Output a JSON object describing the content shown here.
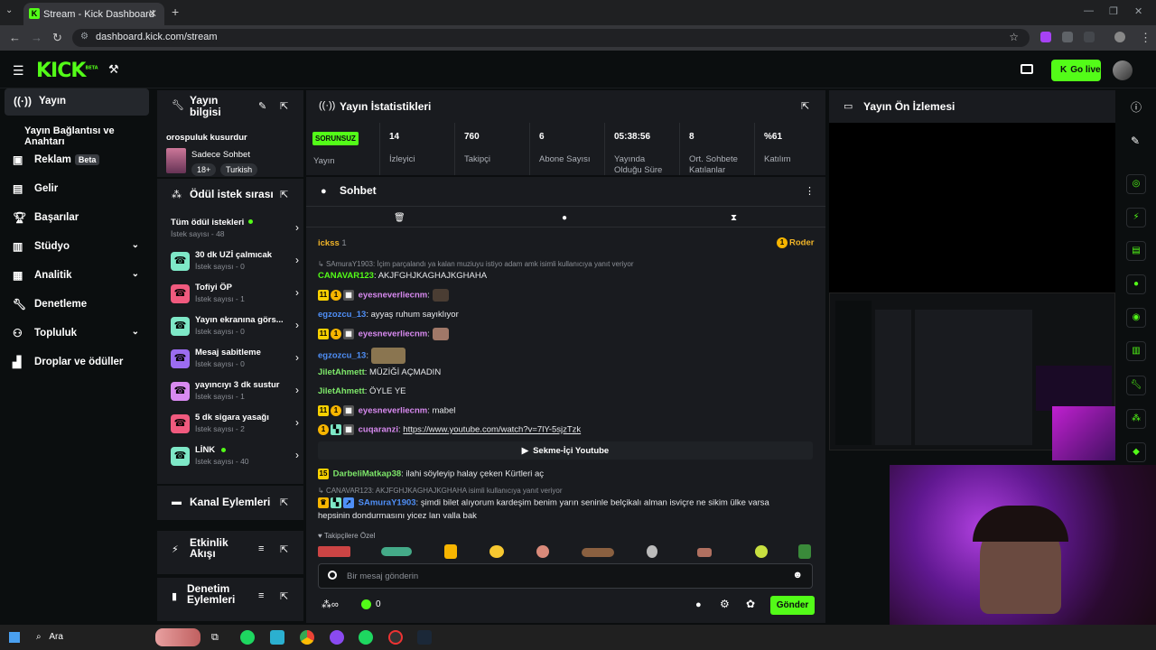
{
  "browser": {
    "tab_title": "Stream - Kick Dashboard",
    "url": "dashboard.kick.com/stream"
  },
  "header": {
    "logo": "KICK",
    "logo_badge": "BETA",
    "go_live": "Go live"
  },
  "sidebar": {
    "items": [
      {
        "label": "Yayın",
        "icon": "broadcast-icon"
      },
      {
        "label": "Yayın Bağlantısı ve Anahtarı",
        "icon": ""
      },
      {
        "label": "Reklam",
        "icon": "ad-icon",
        "badge": "Beta"
      },
      {
        "label": "Gelir",
        "icon": "chart-icon"
      },
      {
        "label": "Başarılar",
        "icon": "trophy-icon"
      },
      {
        "label": "Stüdyo",
        "icon": "studio-icon"
      },
      {
        "label": "Analitik",
        "icon": "analytics-icon"
      },
      {
        "label": "Denetleme",
        "icon": "wrench-icon"
      },
      {
        "label": "Topluluk",
        "icon": "community-icon"
      },
      {
        "label": "Droplar ve ödüller",
        "icon": "drops-icon"
      }
    ]
  },
  "stream_info": {
    "title": "Yayın bilgisi",
    "stream_title": "orospuluk kusurdur",
    "category": "Sadece Sohbet",
    "tags": [
      "18+",
      "Turkish"
    ]
  },
  "rewards": {
    "title": "Ödül istek sırası",
    "items": [
      {
        "name": "Tüm ödül istekleri",
        "count": "İstek sayısı - 48",
        "color": "#53fc18"
      },
      {
        "name": "30 dk UZİ çalmıcak",
        "count": "İstek sayısı - 0",
        "color": "#7ee8c7"
      },
      {
        "name": "Tofiyi ÖP",
        "count": "İstek sayısı - 1",
        "color": "#f05a7e"
      },
      {
        "name": "Yayın ekranına görs...",
        "count": "İstek sayısı - 0",
        "color": "#7ee8c7"
      },
      {
        "name": "Mesaj sabitleme",
        "count": "İstek sayısı - 0",
        "color": "#9b6cf0"
      },
      {
        "name": "yayıncıyı 3 dk sustur",
        "count": "İstek sayısı - 1",
        "color": "#d88af0"
      },
      {
        "name": "5 dk sigara yasağı",
        "count": "İstek sayısı - 2",
        "color": "#f05a7e"
      },
      {
        "name": "LİNK",
        "count": "İstek sayısı - 40",
        "color": "#7ee8c7"
      }
    ]
  },
  "channel_actions": {
    "title": "Kanal Eylemleri"
  },
  "activity": {
    "title": "Etkinlik Akışı"
  },
  "mod_actions": {
    "title": "Denetim Eylemleri"
  },
  "stats": {
    "title": "Yayın İstatistikleri",
    "status": "SORUNSUZ",
    "status_label": "Yayın",
    "items": [
      {
        "value": "14",
        "label": "İzleyici"
      },
      {
        "value": "760",
        "label": "Takipçi"
      },
      {
        "value": "6",
        "label": "Abone Sayısı"
      },
      {
        "value": "05:38:56",
        "label": "Yayında Olduğu Süre"
      },
      {
        "value": "8",
        "label": "Ort. Sohbete Katılanlar"
      },
      {
        "value": "%61",
        "label": "Katılım"
      }
    ]
  },
  "preview": {
    "title": "Yayın Ön İzlemesi"
  },
  "chat": {
    "title": "Sohbet",
    "pinned_user": "ickss",
    "pinned_count": "1",
    "pinned_role": "Roder",
    "messages": [
      {
        "reply": "SAmuraY1903: İçim parçalandı ya kalan muziuyu istiyo adam amk isimli kullanıcıya yanıt veriyor"
      },
      {
        "user": "CANAVAR123",
        "text": "AKJFGHJKAGHAJKGHAHA",
        "color": "#53fc18"
      },
      {
        "user": "eyesneverliecnm",
        "text": "",
        "color": "#d88af0",
        "badge": "11"
      },
      {
        "user": "egzozcu_13",
        "text": "ayyaş ruhum sayıklıyor",
        "color": "#4f8ff7"
      },
      {
        "user": "eyesneverliecnm",
        "text": "",
        "color": "#d88af0",
        "badge": "11"
      },
      {
        "user": "egzozcu_13",
        "text": "",
        "color": "#4f8ff7"
      },
      {
        "user": "JiletAhmett",
        "text": "MÜZİĞİ AÇMADIN",
        "color": "#7ee86a"
      },
      {
        "user": "JiletAhmett",
        "text": "ÖYLE YE",
        "color": "#7ee86a"
      },
      {
        "user": "eyesneverliecnm",
        "text": "mabel",
        "color": "#d88af0",
        "badge": "11"
      },
      {
        "user": "cuqaranzi",
        "text": "https://www.youtube.com/watch?v=7lY-5sjzTzk",
        "color": "#d88af0"
      },
      {
        "user": "DarbeliMatkap38",
        "text": "ilahi söyleyip halay çeken Kürtleri aç",
        "color": "#7ee86a",
        "badge": "15"
      },
      {
        "reply": "CANAVAR123: AKJFGHJKAGHAJKGHAHA isimli kullanıcıya yanıt veriyor"
      },
      {
        "user": "SAmuraY1903",
        "text": "şimdi bilet alıyorum kardeşim benim yarın seninle belçikalı alman isviçre ne sikim ülke varsa",
        "text2": "hepsinin dondurmasını yicez lan valla bak",
        "color": "#4f8ff7"
      }
    ],
    "youtube_label": "Sekme-İçi Youtube",
    "emote_label": "Takipçilere Özel",
    "input_placeholder": "Bir mesaj gönderin",
    "points": "0",
    "infinity": "∞",
    "send": "Gönder"
  },
  "taskbar": {
    "search": "Ara"
  }
}
